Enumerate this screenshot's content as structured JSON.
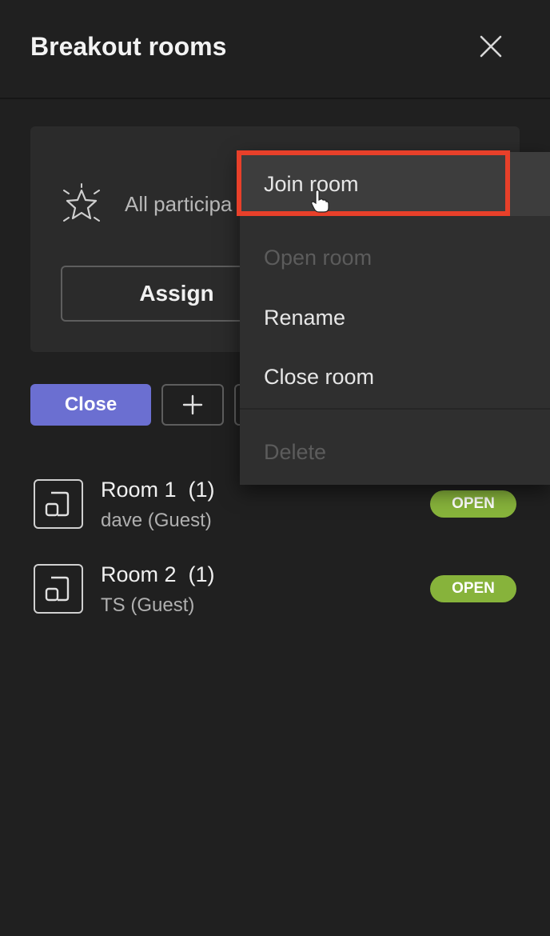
{
  "header": {
    "title": "Breakout rooms"
  },
  "card": {
    "text": "All participa",
    "assign_label": "Assign"
  },
  "actions": {
    "close_label": "Close",
    "add_label": "+"
  },
  "rooms": [
    {
      "name": "Room 1  (1)",
      "participant": "dave (Guest)",
      "status": "OPEN"
    },
    {
      "name": "Room 2  (1)",
      "participant": "TS (Guest)",
      "status": "OPEN"
    }
  ],
  "menu": {
    "items": [
      {
        "label": "Join room",
        "state": "hovered"
      },
      {
        "label": "Open room",
        "state": "disabled"
      },
      {
        "label": "Rename",
        "state": "enabled"
      },
      {
        "label": "Close room",
        "state": "enabled"
      },
      {
        "label": "Delete",
        "state": "disabled"
      }
    ]
  },
  "colors": {
    "background": "#202020",
    "accent": "#6b6fd1",
    "status_open": "#87b33b",
    "highlight": "#e8402a"
  }
}
